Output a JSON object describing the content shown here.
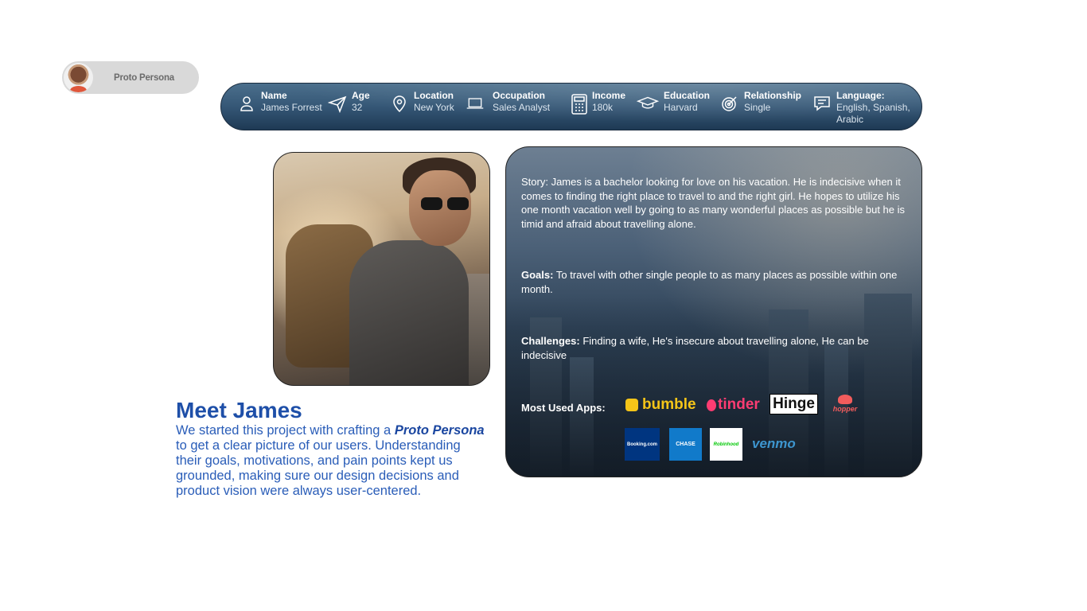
{
  "persona_pill": {
    "label": "Proto Persona",
    "avatar_icon": "avatar-person"
  },
  "info_bar": {
    "fields": [
      {
        "key": "name",
        "label": "Name",
        "value": "James Forrest",
        "icon": "person-icon"
      },
      {
        "key": "age",
        "label": "Age",
        "value": "32",
        "icon": "paper-plane-icon"
      },
      {
        "key": "location",
        "label": "Location",
        "value": "New York",
        "icon": "location-pin-icon"
      },
      {
        "key": "occupation",
        "label": "Occupation",
        "value": "Sales Analyst",
        "icon": "laptop-icon"
      },
      {
        "key": "income",
        "label": "Income",
        "value": "180k",
        "icon": "calculator-icon"
      },
      {
        "key": "education",
        "label": "Education",
        "value": "Harvard",
        "icon": "graduation-cap-icon"
      },
      {
        "key": "relationship",
        "label": "Relationship",
        "value": "Single",
        "icon": "target-icon"
      },
      {
        "key": "language",
        "label": "Language:",
        "value": "English, Spanish, Arabic",
        "icon": "chat-icon"
      }
    ]
  },
  "story_card": {
    "story": "Story: James is a bachelor looking for love on his vacation. He is indecisive when it comes to finding the right place to travel to and the right girl. He hopes to utilize his one month vacation well by going to as many wonderful places as possible but he is timid and afraid about travelling alone.",
    "goals_label": "Goals:",
    "goals_text": "To travel with other single people to as many places as possible within one month.",
    "challenges_label": "Challenges:",
    "challenges_text": "Finding a wife, He's insecure about travelling alone, He can be indecisive",
    "apps_label": "Most Used Apps:",
    "apps": {
      "bumble": "bumble",
      "tinder": "tinder",
      "hinge": "Hinge",
      "hopper": "hopper",
      "booking": "Booking.com",
      "chase": "CHASE",
      "robinhood": "Robinhood",
      "venmo": "venmo"
    }
  },
  "meet": {
    "title": "Meet James",
    "desc_1": "We started this  project with crafting a ",
    "desc_em": "Proto Persona",
    "desc_2": " to get a clear picture of our users. Understanding their goals, motivations, and pain points kept us grounded, making sure our design decisions and product vision were always user-centered."
  },
  "colors": {
    "accent_blue": "#1e4fa8",
    "bar_blue": "#355776"
  }
}
